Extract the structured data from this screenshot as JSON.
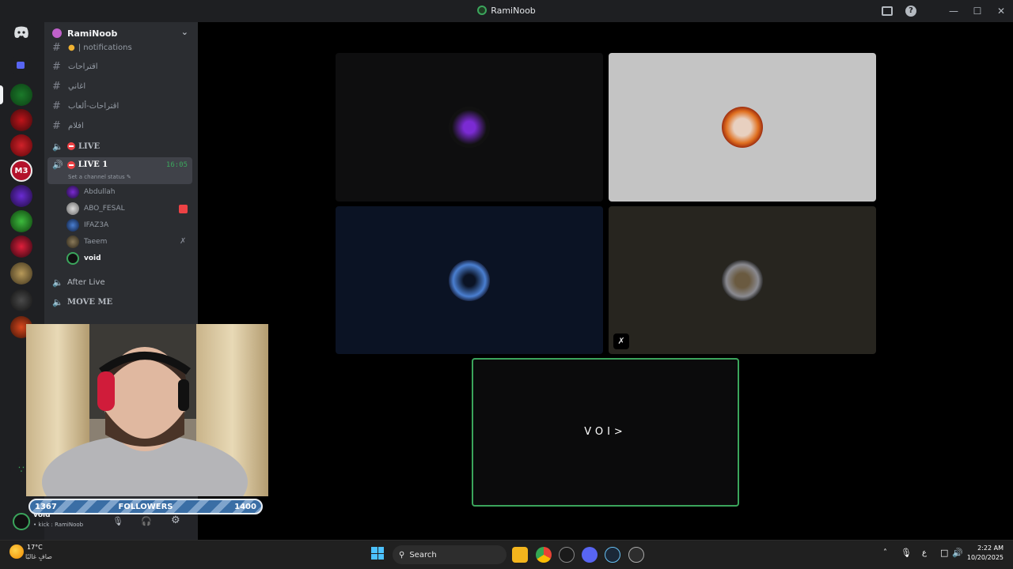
{
  "window": {
    "title": "RamiNoob"
  },
  "guild": {
    "name": "RamiNoob",
    "channels": [
      {
        "type": "text",
        "name": "| notifications"
      },
      {
        "type": "text",
        "name": "اقتراحات"
      },
      {
        "type": "text",
        "name": "اغاني"
      },
      {
        "type": "text",
        "name": "اقتراحات-ألعاب"
      },
      {
        "type": "text",
        "name": "افلام"
      },
      {
        "type": "voice",
        "name": "LIVE"
      },
      {
        "type": "voice",
        "name": "LIVE 1",
        "timer": "16:05",
        "status_hint": "Set a channel status"
      },
      {
        "type": "voice",
        "name": "After Live"
      },
      {
        "type": "voice",
        "name": "MOVE ME"
      }
    ],
    "voice_members": [
      {
        "name": "Abdullah"
      },
      {
        "name": "ABO_FESAL"
      },
      {
        "name": "IFAZ3A"
      },
      {
        "name": "Taeem"
      },
      {
        "name": "void"
      }
    ]
  },
  "user_panel": {
    "name": "void",
    "status": "• kick : RamiNoob"
  },
  "stage": {
    "focused_tile_text": "VOI>"
  },
  "overlay": {
    "followers_current": "1367",
    "followers_label": "FOLLOWERS",
    "followers_goal": "1400"
  },
  "taskbar": {
    "weather_temp": "17°C",
    "weather_desc": "صافٍ غالبًا",
    "search_label": "Search",
    "lang": "ع",
    "time": "2:22 AM",
    "date": "10/20/2025"
  },
  "colors": {
    "accent_green": "#3ba55c",
    "live_red": "#ed4245",
    "stage_focus_border": "#3ba55c"
  }
}
